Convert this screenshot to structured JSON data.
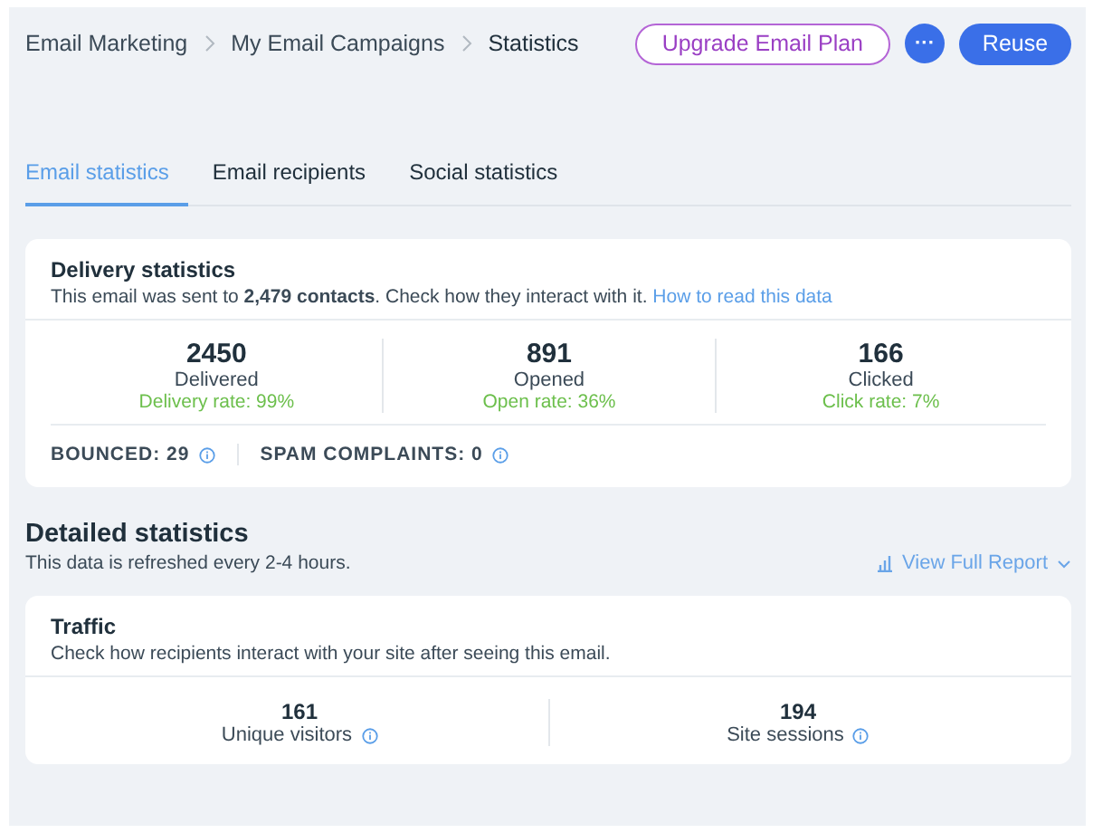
{
  "breadcrumbs": [
    {
      "label": "Email Marketing"
    },
    {
      "label": "My Email Campaigns"
    },
    {
      "label": "Statistics"
    }
  ],
  "actions": {
    "upgrade": "Upgrade Email Plan",
    "more": "···",
    "reuse": "Reuse"
  },
  "tabs": [
    {
      "label": "Email statistics",
      "selected": true
    },
    {
      "label": "Email recipients",
      "selected": false
    },
    {
      "label": "Social statistics",
      "selected": false
    }
  ],
  "delivery": {
    "title": "Delivery statistics",
    "description": "This email was sent to **2,479 contacts**. Check how they interact with it.",
    "link": "How to read this data",
    "metrics": [
      {
        "value": "2450",
        "label": "Delivered",
        "rate": "Delivery rate: 99%"
      },
      {
        "value": "891",
        "label": "Opened",
        "rate": "Open rate: 36%"
      },
      {
        "value": "166",
        "label": "Clicked",
        "rate": "Click rate: 7%"
      }
    ],
    "footer": [
      {
        "label": "BOUNCED: 29"
      },
      {
        "label": "SPAM COMPLAINTS: 0"
      }
    ]
  },
  "detailed": {
    "title": "Detailed statistics",
    "subtitle": "This data is refreshed every 2-4 hours.",
    "report_link": "View Full Report"
  },
  "traffic": {
    "title": "Traffic",
    "description": "Check how recipients interact with your site after seeing this email.",
    "metrics": [
      {
        "value": "161",
        "label": "Unique visitors"
      },
      {
        "value": "194",
        "label": "Site sessions"
      }
    ]
  }
}
